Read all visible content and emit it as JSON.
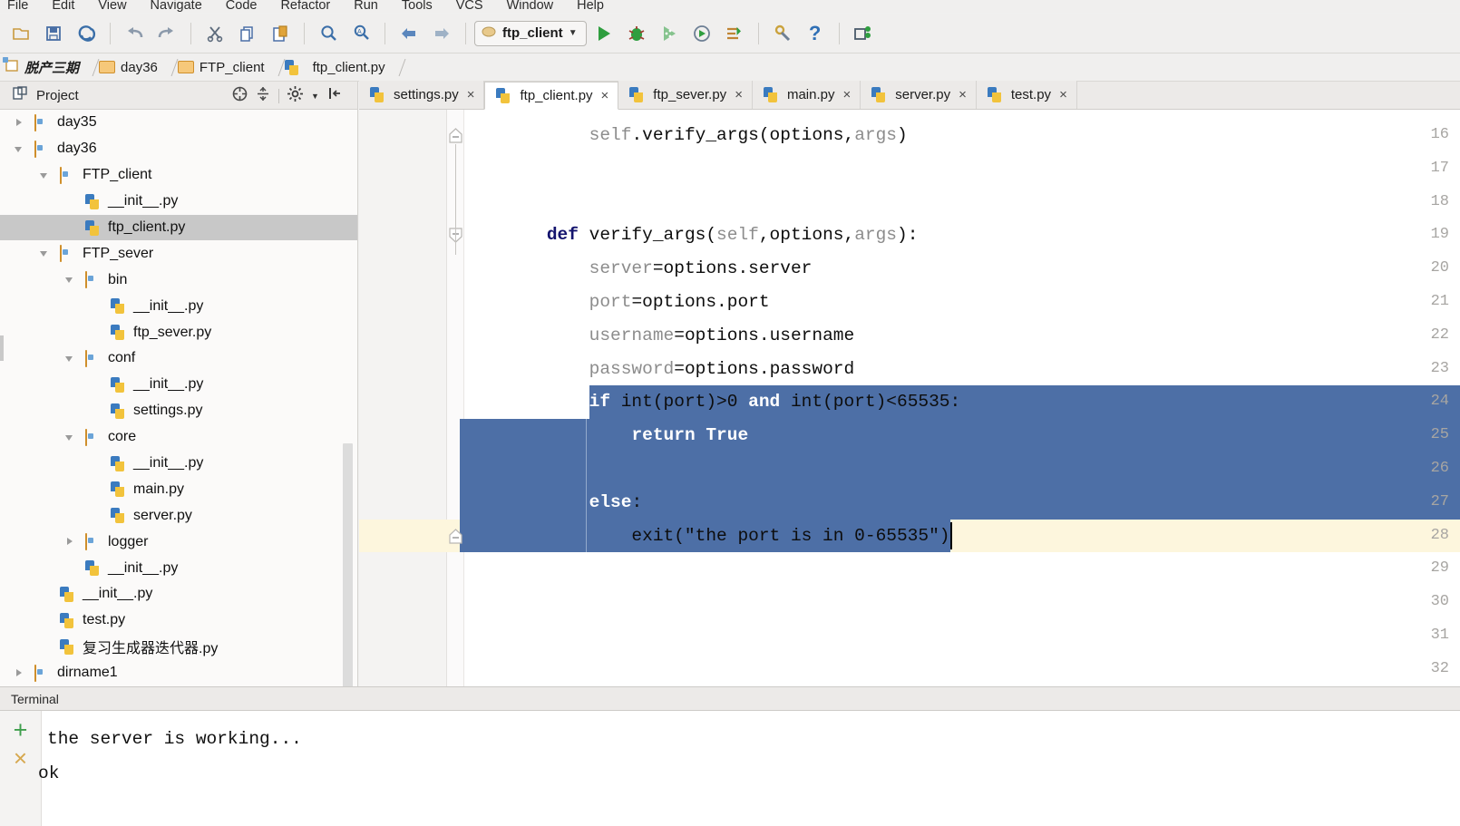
{
  "menu": {
    "items": [
      "File",
      "Edit",
      "View",
      "Navigate",
      "Code",
      "Refactor",
      "Run",
      "Tools",
      "VCS",
      "Window",
      "Help"
    ]
  },
  "toolbar": {
    "icons": [
      "open-icon",
      "save-icon",
      "sync-icon",
      "undo-icon",
      "redo-icon",
      "cut-icon",
      "copy-icon",
      "paste-icon",
      "find-icon",
      "find-in-path-icon",
      "back-icon",
      "forward-icon"
    ],
    "run_config": "ftp_client",
    "run_label": "run-icon",
    "debug_label": "debug-icon",
    "coverage_label": "coverage-icon",
    "profile_label": "profile-icon",
    "console_label": "console-icon",
    "settings_label": "settings-icon",
    "help_label": "?",
    "vcs_label": "vcs-update-icon"
  },
  "breadcrumb": {
    "items": [
      "脱产三期",
      "day36",
      "FTP_client",
      "ftp_client.py"
    ]
  },
  "project": {
    "title": "Project",
    "tools": [
      "collapse-all-icon",
      "scroll-from-source-icon",
      "gear-icon",
      "hide-icon"
    ],
    "tree": [
      {
        "label": "day35",
        "depth": 1,
        "kind": "folder",
        "arrow": "r",
        "selected": false
      },
      {
        "label": "day36",
        "depth": 1,
        "kind": "folder",
        "arrow": "d",
        "selected": false
      },
      {
        "label": "FTP_client",
        "depth": 2,
        "kind": "folder",
        "arrow": "d",
        "selected": false
      },
      {
        "label": "__init__.py",
        "depth": 3,
        "kind": "py",
        "arrow": "",
        "selected": false
      },
      {
        "label": "ftp_client.py",
        "depth": 3,
        "kind": "py",
        "arrow": "",
        "selected": true
      },
      {
        "label": "FTP_sever",
        "depth": 2,
        "kind": "folder",
        "arrow": "d",
        "selected": false
      },
      {
        "label": "bin",
        "depth": 3,
        "kind": "folder",
        "arrow": "d",
        "selected": false
      },
      {
        "label": "__init__.py",
        "depth": 4,
        "kind": "py",
        "arrow": "",
        "selected": false
      },
      {
        "label": "ftp_sever.py",
        "depth": 4,
        "kind": "py",
        "arrow": "",
        "selected": false
      },
      {
        "label": "conf",
        "depth": 3,
        "kind": "folder",
        "arrow": "d",
        "selected": false
      },
      {
        "label": "__init__.py",
        "depth": 4,
        "kind": "py",
        "arrow": "",
        "selected": false
      },
      {
        "label": "settings.py",
        "depth": 4,
        "kind": "py",
        "arrow": "",
        "selected": false
      },
      {
        "label": "core",
        "depth": 3,
        "kind": "folder",
        "arrow": "d",
        "selected": false
      },
      {
        "label": "__init__.py",
        "depth": 4,
        "kind": "py",
        "arrow": "",
        "selected": false
      },
      {
        "label": "main.py",
        "depth": 4,
        "kind": "py",
        "arrow": "",
        "selected": false
      },
      {
        "label": "server.py",
        "depth": 4,
        "kind": "py",
        "arrow": "",
        "selected": false
      },
      {
        "label": "logger",
        "depth": 3,
        "kind": "folder",
        "arrow": "r",
        "selected": false
      },
      {
        "label": "__init__.py",
        "depth": 3,
        "kind": "py",
        "arrow": "",
        "selected": false
      },
      {
        "label": "__init__.py",
        "depth": 2,
        "kind": "py",
        "arrow": "",
        "selected": false
      },
      {
        "label": "test.py",
        "depth": 2,
        "kind": "py",
        "arrow": "",
        "selected": false
      },
      {
        "label": "复习生成器迭代器.py",
        "depth": 2,
        "kind": "py",
        "arrow": "",
        "selected": false
      },
      {
        "label": "dirname1",
        "depth": 1,
        "kind": "folder",
        "arrow": "r",
        "selected": false
      }
    ]
  },
  "tabs": [
    {
      "label": "settings.py",
      "active": false,
      "close": "×"
    },
    {
      "label": "ftp_client.py",
      "active": true,
      "close": "×"
    },
    {
      "label": "ftp_sever.py",
      "active": false,
      "close": "×"
    },
    {
      "label": "main.py",
      "active": false,
      "close": "×"
    },
    {
      "label": "server.py",
      "active": false,
      "close": "×"
    },
    {
      "label": "test.py",
      "active": false,
      "close": "×"
    }
  ],
  "editor": {
    "first_line": 16,
    "cursor_line": 28,
    "selection_start_line": 24,
    "selection_end_line": 28,
    "selection_color": "#4d6fa6",
    "current_line_color": "#fdf6dd",
    "lines": [
      {
        "n": 16,
        "text": "        self.verify_args(options,args)"
      },
      {
        "n": 17,
        "text": ""
      },
      {
        "n": 18,
        "text": ""
      },
      {
        "n": 19,
        "text": "    def verify_args(self,options,args):"
      },
      {
        "n": 20,
        "text": "        server=options.server"
      },
      {
        "n": 21,
        "text": "        port=options.port"
      },
      {
        "n": 22,
        "text": "        username=options.username"
      },
      {
        "n": 23,
        "text": "        password=options.password"
      },
      {
        "n": 24,
        "text": "        if int(port)>0 and int(port)<65535:"
      },
      {
        "n": 25,
        "text": "            return True"
      },
      {
        "n": 26,
        "text": ""
      },
      {
        "n": 27,
        "text": "        else:"
      },
      {
        "n": 28,
        "text": "            exit(\"the port is in 0-65535\")"
      },
      {
        "n": 29,
        "text": ""
      },
      {
        "n": 30,
        "text": ""
      },
      {
        "n": 31,
        "text": ""
      },
      {
        "n": 32,
        "text": ""
      }
    ]
  },
  "terminal": {
    "tab_label": "Terminal",
    "add_icon": "+",
    "close_icon": "×",
    "output": [
      "the server is working...",
      "ok"
    ]
  }
}
